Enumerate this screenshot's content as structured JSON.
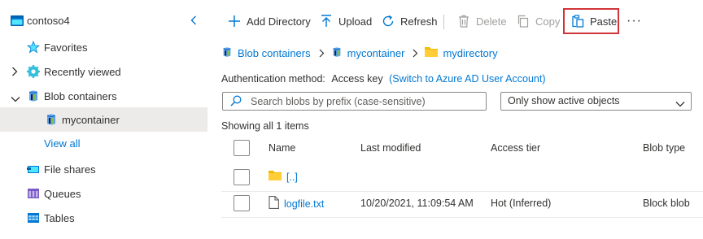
{
  "sidebar": {
    "account_name": "contoso4",
    "items": [
      {
        "label": "Favorites"
      },
      {
        "label": "Recently viewed"
      },
      {
        "label": "Blob containers"
      },
      {
        "label": "mycontainer"
      },
      {
        "label": "File shares"
      },
      {
        "label": "Queues"
      },
      {
        "label": "Tables"
      }
    ],
    "view_all": "View all"
  },
  "toolbar": {
    "add_directory": "Add Directory",
    "upload": "Upload",
    "refresh": "Refresh",
    "delete": "Delete",
    "copy": "Copy",
    "paste": "Paste",
    "more": "···"
  },
  "breadcrumb": [
    "Blob containers",
    "mycontainer",
    "mydirectory"
  ],
  "auth": {
    "label": "Authentication method:",
    "value": "Access key",
    "link": "(Switch to Azure AD User Account)"
  },
  "search": {
    "placeholder": "Search blobs by prefix (case-sensitive)",
    "value": ""
  },
  "filter": {
    "selected": "Only show active objects"
  },
  "status": "Showing all 1 items",
  "table": {
    "columns": [
      "Name",
      "Last modified",
      "Access tier",
      "Blob type"
    ],
    "rows": [
      {
        "name": "[..]",
        "last_modified": "",
        "access_tier": "",
        "blob_type": "",
        "icon": "folder-icon"
      },
      {
        "name": "logfile.txt",
        "last_modified": "10/20/2021, 11:09:54 AM",
        "access_tier": "Hot (Inferred)",
        "blob_type": "Block blob",
        "icon": "file-icon"
      }
    ]
  },
  "colors": {
    "accent": "#0078d4",
    "folder": "#f2b900",
    "highlight_border": "#d13438",
    "selected_bg": "#edebe9"
  }
}
